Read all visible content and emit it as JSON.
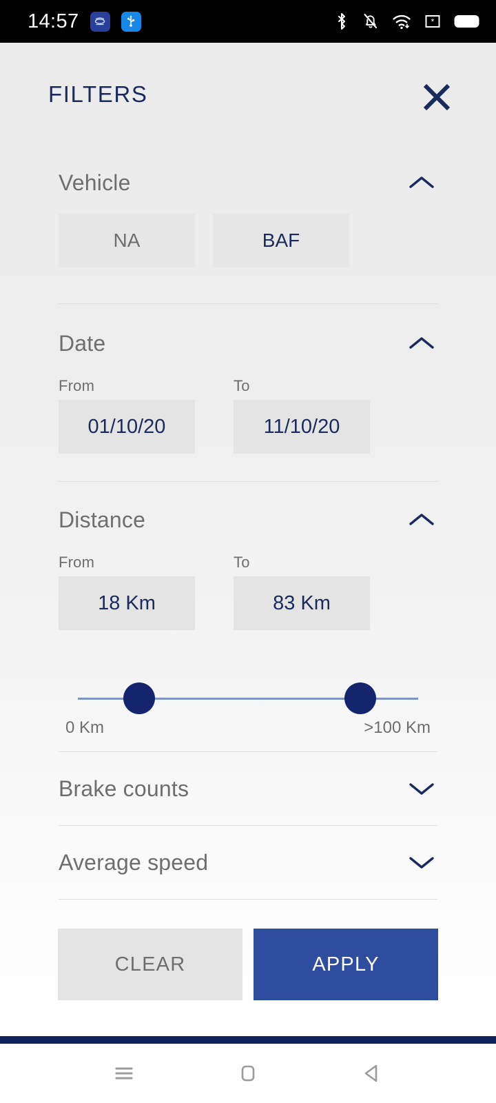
{
  "statusbar": {
    "clock": "14:57",
    "left_icons": [
      "app-icon",
      "usb-icon"
    ],
    "right_icons": [
      "bluetooth-icon",
      "notifications-muted-icon",
      "wifi-icon",
      "sim-icon",
      "battery-icon"
    ]
  },
  "header": {
    "title": "FILTERS",
    "close_icon": "close-icon"
  },
  "sections": {
    "vehicle": {
      "title": "Vehicle",
      "expanded": true,
      "chevron": "chevron-up-icon",
      "chips": [
        {
          "label": "NA",
          "selected": false
        },
        {
          "label": "BAF",
          "selected": true
        }
      ]
    },
    "date": {
      "title": "Date",
      "expanded": true,
      "chevron": "chevron-up-icon",
      "from_label": "From",
      "from_value": "01/10/20",
      "to_label": "To",
      "to_value": "11/10/20"
    },
    "distance": {
      "title": "Distance",
      "expanded": true,
      "chevron": "chevron-up-icon",
      "from_label": "From",
      "from_value": "18 Km",
      "to_label": "To",
      "to_value": "83 Km",
      "slider": {
        "min_label": "0 Km",
        "max_label": ">100 Km",
        "low_percent": 18,
        "high_percent": 83
      }
    },
    "brake_counts": {
      "title": "Brake counts",
      "expanded": false,
      "chevron": "chevron-down-icon"
    },
    "average_speed": {
      "title": "Average speed",
      "expanded": false,
      "chevron": "chevron-down-icon"
    }
  },
  "footer": {
    "clear_label": "CLEAR",
    "apply_label": "APPLY"
  },
  "navbar": {
    "recents_icon": "menu-icon",
    "home_icon": "home-square-icon",
    "back_icon": "back-triangle-icon"
  },
  "colors": {
    "accent_navy": "#1b2a5c",
    "apply_blue": "#2f4d9e",
    "thumb_navy": "#14256e",
    "track_blue": "#7e94c4",
    "box_gray": "#e4e4e4",
    "muted_text": "#6e6e6e"
  }
}
